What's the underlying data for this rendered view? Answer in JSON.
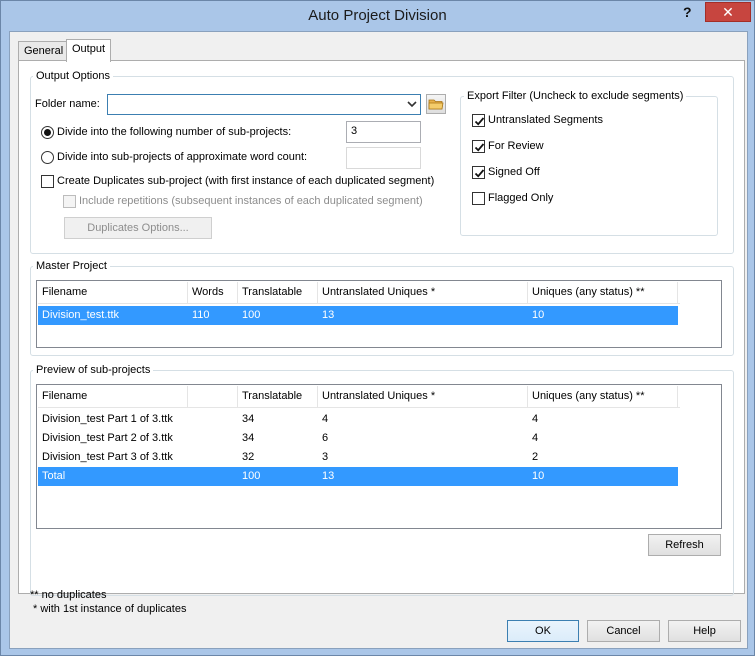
{
  "window": {
    "title": "Auto Project Division",
    "help_glyph": "?",
    "close_glyph": "✕"
  },
  "tabs": [
    {
      "label": "General"
    },
    {
      "label": "Output"
    }
  ],
  "output_options": {
    "group_label": "Output Options",
    "folder_label": "Folder name:",
    "folder_value": "",
    "radio_subprojects_label": "Divide into the following number of sub-projects:",
    "subprojects_value": "3",
    "radio_wordcount_label": "Divide into sub-projects of approximate word count:",
    "wordcount_value": "",
    "duplicates_label": "Create Duplicates sub-project (with first instance of each duplicated segment)",
    "repetitions_label": "Include repetitions (subsequent instances of each duplicated segment)",
    "duplicates_options_label": "Duplicates Options..."
  },
  "export_filter": {
    "group_label": "Export Filter (Uncheck to exclude segments)",
    "items": [
      {
        "label": "Untranslated Segments",
        "checked": true
      },
      {
        "label": "For Review",
        "checked": true
      },
      {
        "label": "Signed Off",
        "checked": true
      },
      {
        "label": "Flagged Only",
        "checked": false
      }
    ]
  },
  "master_project": {
    "group_label": "Master Project",
    "columns": [
      "Filename",
      "Words",
      "Translatable",
      "Untranslated Uniques *",
      "Uniques (any status) **"
    ],
    "rows": [
      [
        "Division_test.ttk",
        "110",
        "100",
        "13",
        "10"
      ]
    ]
  },
  "preview": {
    "group_label": "Preview of sub-projects",
    "columns": [
      "Filename",
      "",
      "Translatable",
      "Untranslated Uniques *",
      "Uniques (any status) **"
    ],
    "rows": [
      [
        "Division_test Part 1 of 3.ttk",
        "",
        "34",
        "4",
        "4"
      ],
      [
        "Division_test Part 2 of 3.ttk",
        "",
        "34",
        "6",
        "4"
      ],
      [
        "Division_test Part 3 of 3.ttk",
        "",
        "32",
        "3",
        "2"
      ],
      [
        "Total",
        "",
        "100",
        "13",
        "10"
      ]
    ],
    "refresh_label": "Refresh"
  },
  "footnotes": {
    "line1": "* with 1st instance of duplicates",
    "line2": "** no duplicates"
  },
  "buttons": {
    "ok": "OK",
    "cancel": "Cancel",
    "help": "Help"
  }
}
